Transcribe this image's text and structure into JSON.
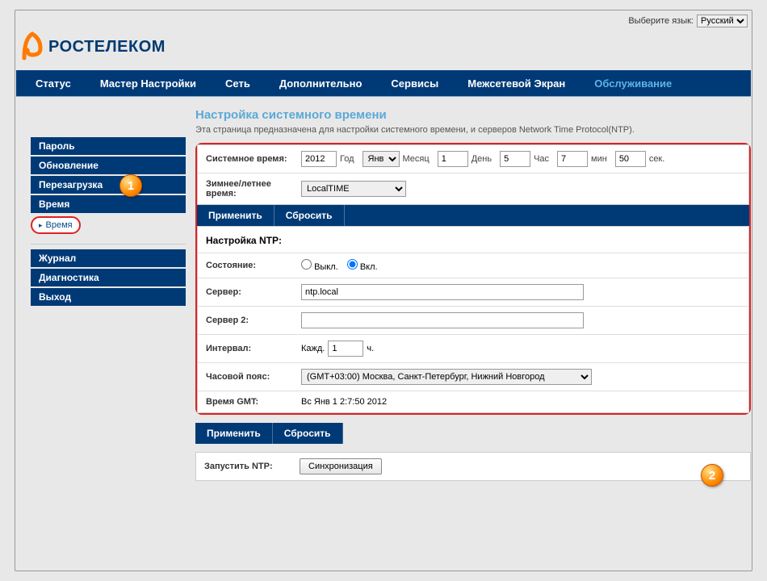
{
  "lang": {
    "label": "Выберите язык:",
    "value": "Русский"
  },
  "brand": "РОСТЕЛЕКОМ",
  "nav": [
    "Статус",
    "Мастер Настройки",
    "Сеть",
    "Дополнительно",
    "Сервисы",
    "Межсетевой Экран",
    "Обслуживание"
  ],
  "sidebar": {
    "items": [
      "Пароль",
      "Обновление",
      "Перезагрузка",
      "Время"
    ],
    "sub": "Время",
    "items2": [
      "Журнал",
      "Диагностика",
      "Выход"
    ]
  },
  "page": {
    "title": "Настройка системного времени",
    "desc": "Эта страница предназначена для настройки системного времени, и серверов Network Time Protocol(NTP)."
  },
  "time": {
    "label": "Системное время:",
    "year": "2012",
    "year_u": "Год",
    "month": "Янв",
    "month_u": "Месяц",
    "day": "1",
    "day_u": "День",
    "hour": "5",
    "hour_u": "Час",
    "min": "7",
    "min_u": "мин",
    "sec": "50",
    "sec_u": "сек."
  },
  "dst": {
    "label": "Зимнее/летнее время:",
    "value": "LocalTIME"
  },
  "buttons": {
    "apply": "Применить",
    "reset": "Сбросить"
  },
  "ntp": {
    "head": "Настройка NTP:",
    "state_l": "Состояние:",
    "off": "Выкл.",
    "on": "Вкл.",
    "server_l": "Сервер:",
    "server": "ntp.local",
    "server2_l": "Сервер 2:",
    "server2": "",
    "interval_l": "Интервал:",
    "each": "Кажд.",
    "interval": "1",
    "hours": "ч.",
    "tz_l": "Часовой пояс:",
    "tz": "(GMT+03:00) Москва, Санкт-Петербург, Нижний Новгород",
    "gmt_l": "Время GMT:",
    "gmt": "Вс Янв 1 2:7:50 2012"
  },
  "run": {
    "label": "Запустить NTP:",
    "btn": "Синхронизация"
  },
  "badges": {
    "b1": "1",
    "b2": "2"
  }
}
